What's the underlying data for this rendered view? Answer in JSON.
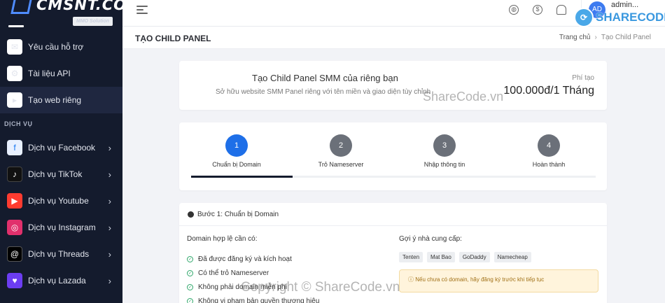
{
  "sidebar": {
    "brand": "CMSNT.CO",
    "tagline": "MMO Solution",
    "items_top": [
      {
        "label": "Yêu cầu hỗ trợ",
        "icon": "support-icon"
      },
      {
        "label": "Tài liệu API",
        "icon": "api-icon"
      },
      {
        "label": "Tạo web riêng",
        "icon": "terminal-icon"
      }
    ],
    "section": "DỊCH VỤ",
    "services": [
      {
        "label": "Dịch vụ Facebook",
        "icon": "facebook-icon"
      },
      {
        "label": "Dịch vụ TikTok",
        "icon": "tiktok-icon"
      },
      {
        "label": "Dịch vụ Youtube",
        "icon": "youtube-icon"
      },
      {
        "label": "Dịch vụ Instagram",
        "icon": "instagram-icon"
      },
      {
        "label": "Dịch vụ Threads",
        "icon": "threads-icon"
      },
      {
        "label": "Dịch vụ Lazada",
        "icon": "lazada-icon"
      }
    ]
  },
  "topbar": {
    "user_initials": "AD",
    "user_name": "admin..."
  },
  "header": {
    "title": "TẠO CHILD PANEL",
    "breadcrumb_home": "Trang chủ",
    "breadcrumb_current": "Tạo Child Panel"
  },
  "hero": {
    "title": "Tạo Child Panel SMM của riêng bạn",
    "subtitle": "Sở hữu website SMM Panel riêng với tên miền và giao diện tùy chỉnh",
    "fee_label": "Phí tạo",
    "fee_value": "100.000đ/1 Tháng"
  },
  "steps": [
    {
      "num": "1",
      "label": "Chuẩn bị Domain"
    },
    {
      "num": "2",
      "label": "Trỏ Nameserver"
    },
    {
      "num": "3",
      "label": "Nhập thông tin"
    },
    {
      "num": "4",
      "label": "Hoàn thành"
    }
  ],
  "progress_fraction": 0.25,
  "step1": {
    "heading": "Bước 1: Chuẩn bị Domain",
    "requirements_title": "Domain hợp lệ cần có:",
    "requirements": [
      "Đã được đăng ký và kích hoạt",
      "Có thể trỏ Nameserver",
      "Không phải domain miễn phí",
      "Không vi phạm bản quyền thương hiệu"
    ],
    "providers_title": "Gợi ý nhà cung cấp:",
    "providers": [
      "Tenten",
      "Mat Bao",
      "GoDaddy",
      "Namecheap"
    ],
    "note": "Nếu chưa có domain, hãy đăng ký trước khi tiếp tục"
  },
  "watermarks": {
    "logo": "SHARECODE.vn",
    "middle": "ShareCode.vn",
    "bottom": "Copyright © ShareCode.vn"
  },
  "colors": {
    "sidebar_bg": "#141b2d",
    "accent": "#1e6fe8"
  }
}
